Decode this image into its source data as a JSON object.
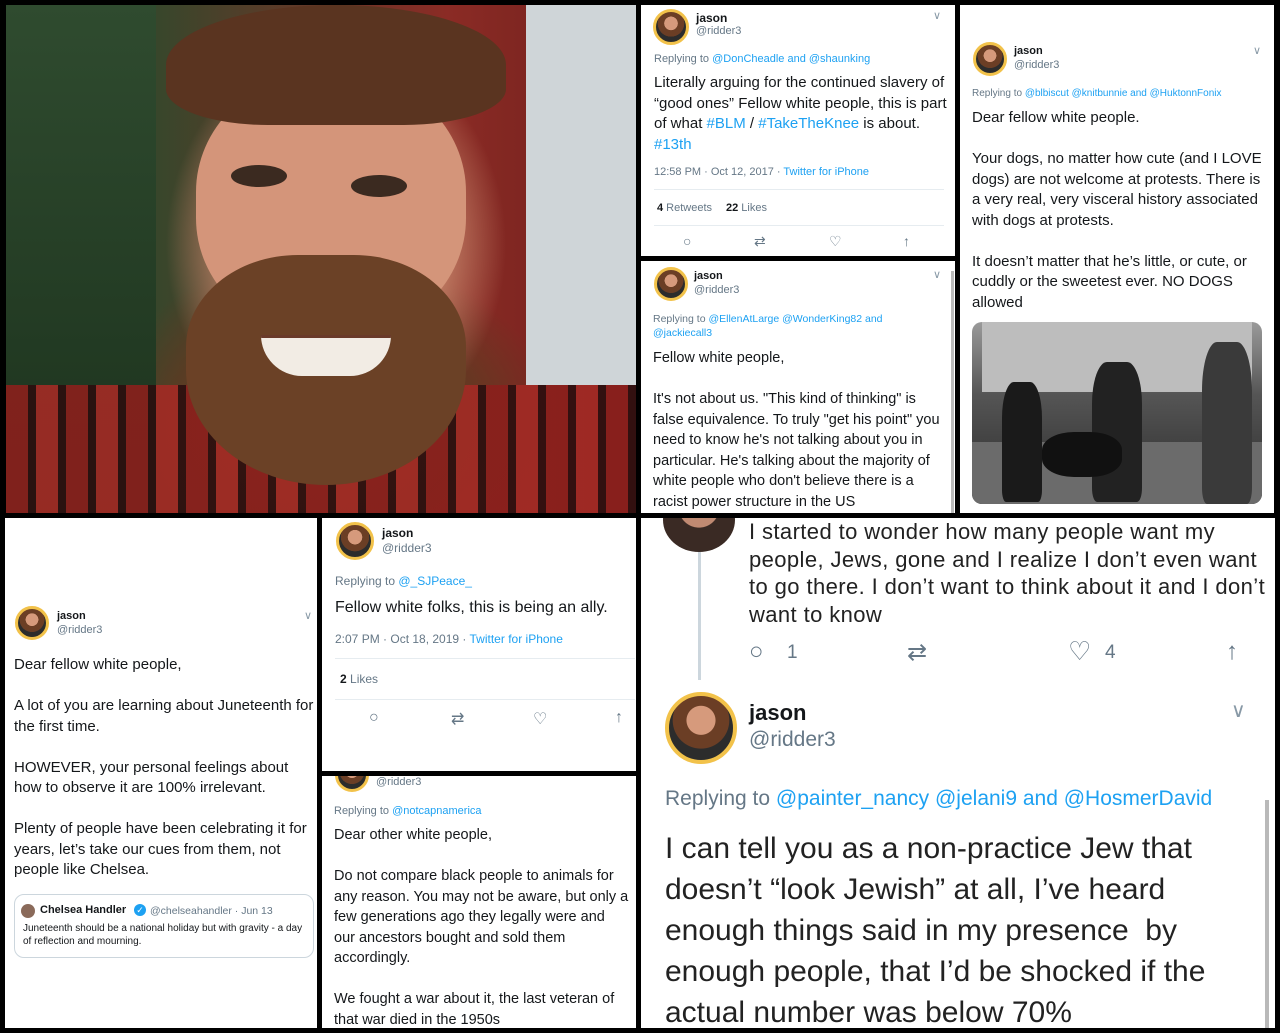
{
  "photo": {
    "alt_icon": "person-photo"
  },
  "t1": {
    "name": "jason",
    "handle": "@ridder3",
    "replying_prefix": "Replying to ",
    "replying_to": "@DonCheadle and @shaunking",
    "text_1": "Literally arguing for the continued slavery of “good ones” Fellow white people, this is part of what ",
    "tag_1": "#BLM",
    "sep": " / ",
    "tag_2": "#TakeTheKnee",
    "text_2": " is about. ",
    "tag_3": "#13th",
    "time": "12:58 PM · Oct 12, 2017 · ",
    "source": "Twitter for iPhone",
    "retweets_count": "4",
    "retweets_label": " Retweets",
    "likes_count": "22",
    "likes_label": " Likes"
  },
  "t2": {
    "name": "jason",
    "handle": "@ridder3",
    "replying_prefix": "Replying to ",
    "replying_to": "@blbiscut @knitbunnie and @HuktonnFonix",
    "text": "Dear fellow white people.\n\nYour dogs, no matter how cute (and I LOVE dogs) are not welcome at protests. There is a very real, very visceral history associated with dogs at protests.\n\nIt doesn’t matter that he’s little, or cute, or cuddly or the sweetest ever. NO DOGS allowed"
  },
  "t3": {
    "name": "jason",
    "handle": "@ridder3",
    "replying_prefix": "Replying to ",
    "replying_to": "@EllenAtLarge @WonderKing82 and @jackiecall3",
    "text": "Fellow white people,\n\nIt's not about us. \"This kind of thinking\" is false equivalence. To truly \"get his point\" you need to know he's not talking about you in particular. He's talking about the majority of white people who don't believe there is a racist power structure in the US"
  },
  "t4": {
    "name": "jason",
    "handle": "@ridder3",
    "text": "Dear fellow white people,\n\nA lot of you are learning about Juneteenth for the first time.\n\nHOWEVER, your personal feelings about how to observe it are 100% irrelevant.\n\nPlenty of people have been celebrating it for years, let’s take our cues from them, not people like Chelsea.",
    "quote_name": "Chelsea Handler",
    "quote_handle": "@chelseahandler · Jun 13",
    "quote_text": "Juneteenth should be a national holiday but with gravity - a day of reflection and mourning."
  },
  "t5": {
    "name": "jason",
    "handle": "@ridder3",
    "replying_prefix": "Replying to ",
    "replying_to": "@_SJPeace_",
    "text": "Fellow white folks, this is being an ally.",
    "time": "2:07 PM · Oct 18, 2019 · ",
    "source": "Twitter for iPhone",
    "likes_count": "2",
    "likes_label": " Likes"
  },
  "t6": {
    "handle": "@ridder3",
    "replying_prefix": "Replying to ",
    "replying_to": "@notcapnamerica",
    "text": "Dear other white people,\n\nDo not compare black people to animals for any reason. You may not be aware, but only a few generations ago they legally were and our ancestors bought and sold them accordingly.\n\nWe fought a war about it, the last veteran of that war died in the 1950s"
  },
  "t7": {
    "text": "I started to wonder how many people want my people, Jews, gone and I realize I don’t even want to go there. I don’t want to think about it and I don’t want to know",
    "replies": "1",
    "likes": "4"
  },
  "t8": {
    "name": "jason",
    "handle": "@ridder3",
    "replying_prefix": "Replying to ",
    "replying_to": "@painter_nancy @jelani9 and @HosmerDavid",
    "text": "I can tell you as a non-practice Jew that doesn’t “look Jewish” at all, I’ve heard enough things said in my presence  by enough people, that I’d be shocked if the actual number was below 70%"
  },
  "icons": {
    "reply": "○",
    "retweet": "⇄",
    "like": "♡",
    "share": "↑",
    "chevron": "∨"
  }
}
